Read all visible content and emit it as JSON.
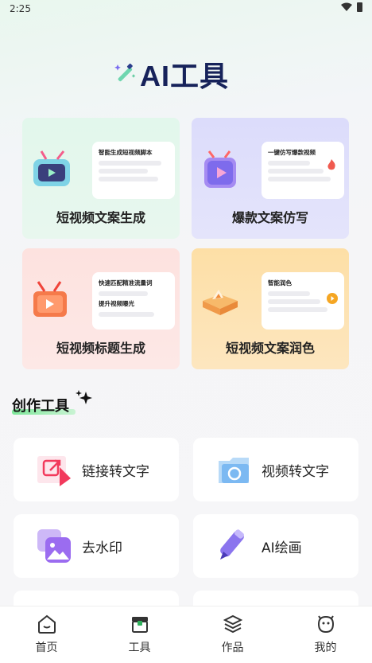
{
  "status_bar": {
    "time": "2:25"
  },
  "header": {
    "title": "AI工具"
  },
  "feature_cards": [
    {
      "label": "短视频文案生成",
      "preview_title": "智能生成短视频脚本"
    },
    {
      "label": "爆款文案仿写",
      "preview_title": "一键仿写爆款视频"
    },
    {
      "label": "短视频标题生成",
      "preview_title": "快速匹配精准流量词",
      "preview_subtitle": "提升视频曝光"
    },
    {
      "label": "短视频文案润色",
      "preview_title": "智能润色"
    }
  ],
  "section": {
    "title": "创作工具"
  },
  "tools": [
    {
      "label": "链接转文字",
      "icon": "link-doc-icon"
    },
    {
      "label": "视频转文字",
      "icon": "camera-folder-icon"
    },
    {
      "label": "去水印",
      "icon": "image-icon"
    },
    {
      "label": "AI绘画",
      "icon": "pen-icon"
    }
  ],
  "tab_bar": {
    "items": [
      {
        "label": "首页",
        "icon": "home-icon"
      },
      {
        "label": "工具",
        "icon": "toolbox-icon",
        "active": true
      },
      {
        "label": "作品",
        "icon": "layers-icon"
      },
      {
        "label": "我的",
        "icon": "face-icon"
      }
    ]
  },
  "colors": {
    "card1_bg": "#e3f6ec",
    "card2_bg": "#dfe0fb",
    "card3_bg": "#fde3e1",
    "card4_bg": "#fde4b8",
    "title": "#16225a",
    "accent_green": "#2fb15c"
  }
}
